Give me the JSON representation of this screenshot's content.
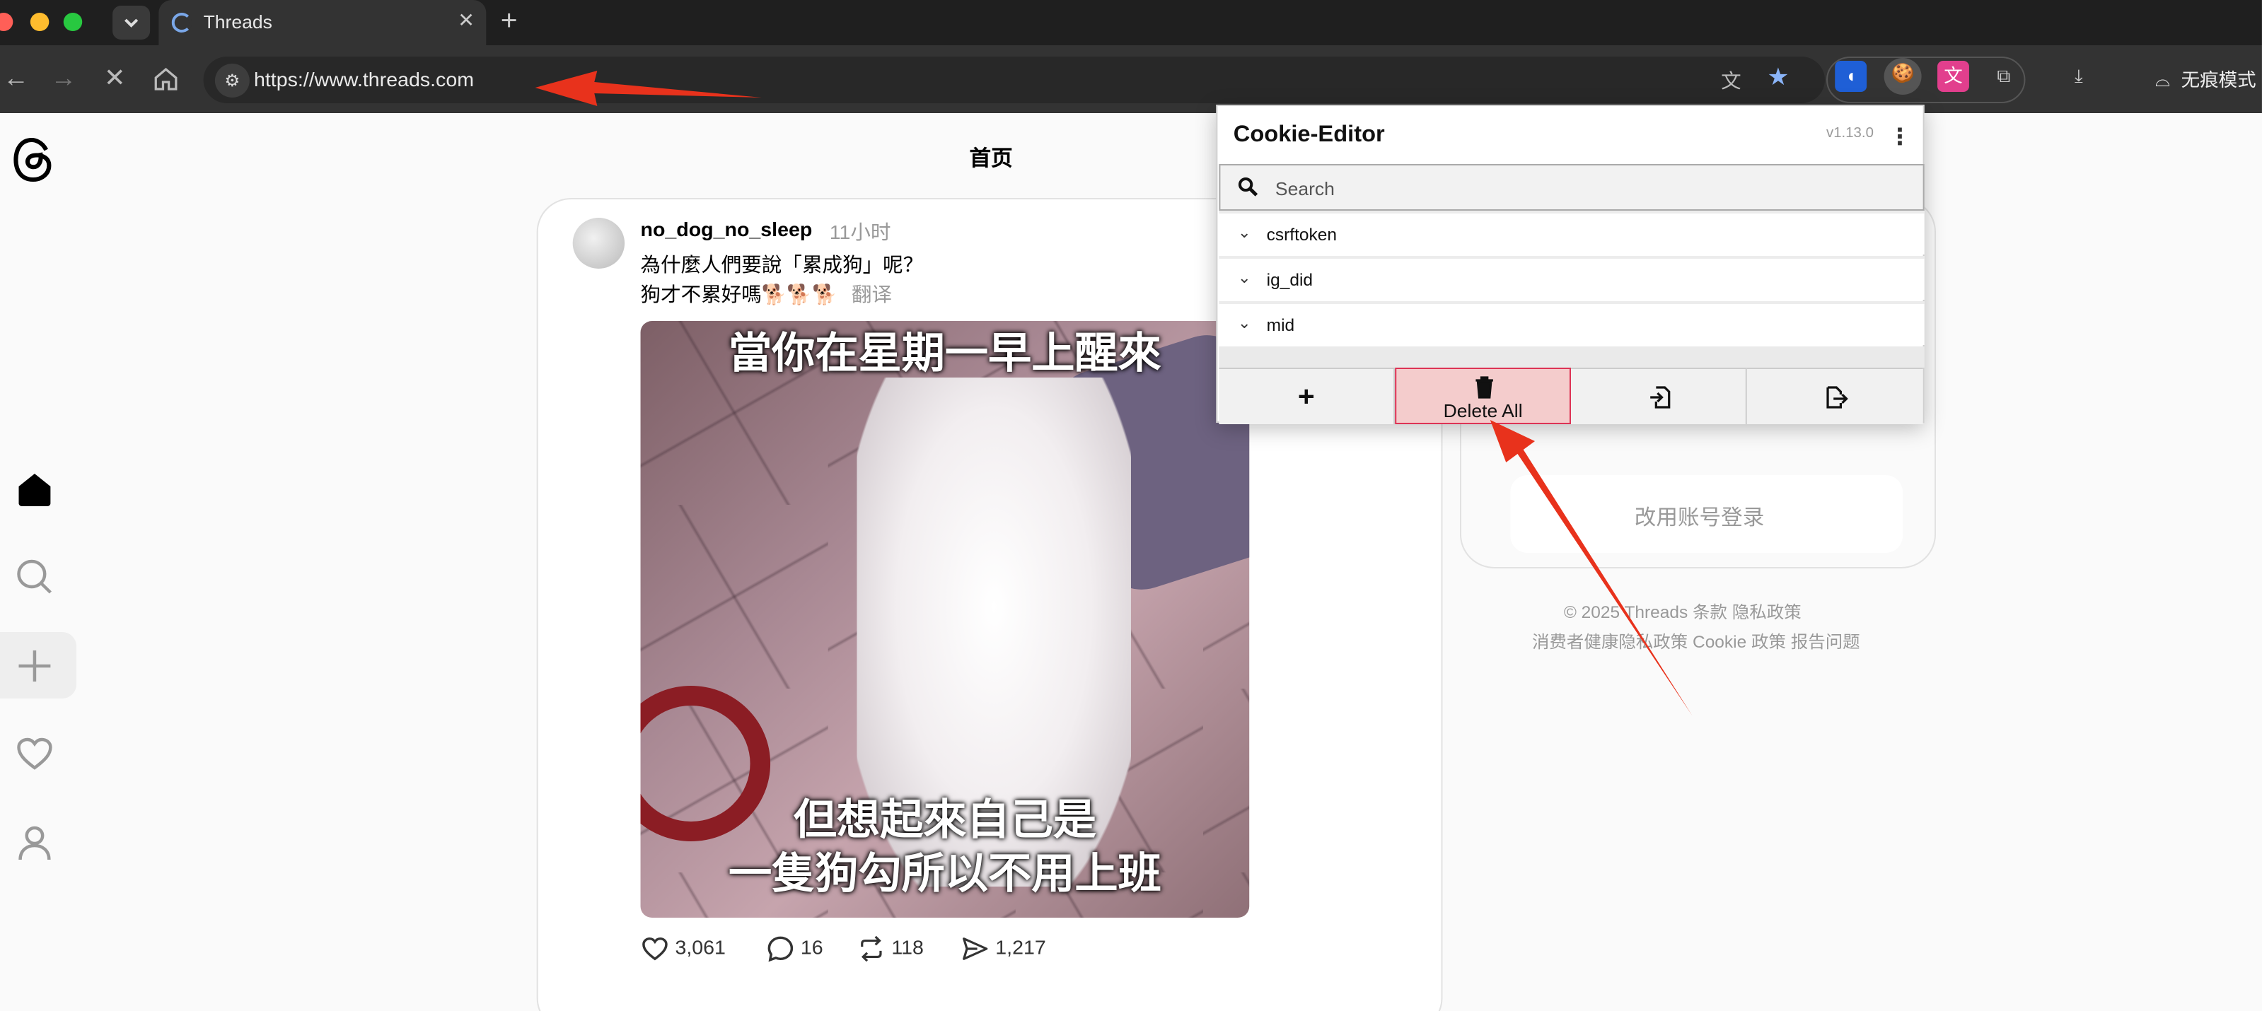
{
  "browser": {
    "tab_title": "Threads",
    "new_tab": "+",
    "close_tab": "✕",
    "url": "https://www.threads.com",
    "incognito_label": "无痕模式"
  },
  "page": {
    "title": "首页"
  },
  "post": {
    "username": "no_dog_no_sleep",
    "time": "11小时",
    "line1": "為什麼人們要說「累成狗」呢？",
    "line2": "狗才不累好嗎🐕🐕🐕",
    "translate": "翻译",
    "caption_top": "當你在星期一早上醒來",
    "caption_bottom_1": "但想起來自己是",
    "caption_bottom_2": "一隻狗勾所以不用上班",
    "likes": "3,061",
    "comments": "16",
    "reposts": "118",
    "shares": "1,217"
  },
  "right_panel": {
    "switch_login": "改用账号登录",
    "footer_line1": "© 2025   Threads 条款   隐私政策",
    "footer_line2": "消费者健康隐私政策   Cookie 政策   报告问题"
  },
  "cookie_editor": {
    "title": "Cookie-Editor",
    "version": "v1.13.0",
    "search_placeholder": "Search",
    "cookies": [
      "csrftoken",
      "ig_did",
      "mid"
    ],
    "add_label": "+",
    "delete_all_label": "Delete All"
  },
  "colors": {
    "annotation_arrow": "#e8321c",
    "delete_bg": "#f4cccc"
  }
}
